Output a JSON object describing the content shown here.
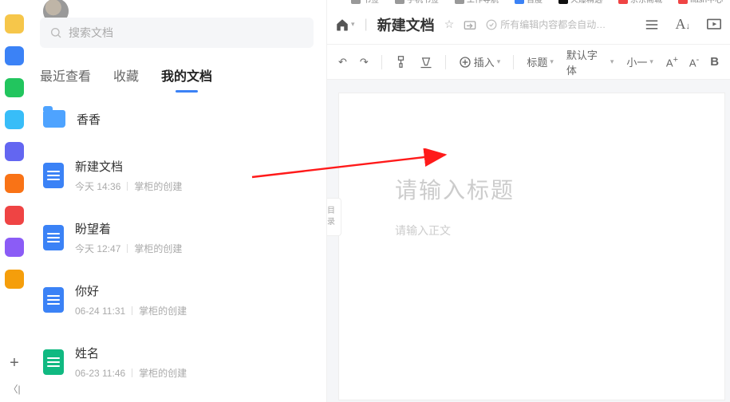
{
  "rail_colors": [
    "#f6c64a",
    "#3b82f6",
    "#22c55e",
    "#38bdf8",
    "#6366f1",
    "#f97316",
    "#ef4444",
    "#8b5cf6",
    "#f59e0b"
  ],
  "search": {
    "placeholder": "搜索文档"
  },
  "tabs": {
    "recent": "最近查看",
    "favorite": "收藏",
    "mydocs": "我的文档"
  },
  "folder": {
    "name": "香香"
  },
  "docs": [
    {
      "title": "新建文档",
      "time": "今天 14:36",
      "by": "掌柜的创建",
      "color": "blue"
    },
    {
      "title": "盼望着",
      "time": "今天 12:47",
      "by": "掌柜的创建",
      "color": "blue"
    },
    {
      "title": "你好",
      "time": "06-24 11:31",
      "by": "掌柜的创建",
      "color": "blue"
    },
    {
      "title": "姓名",
      "time": "06-23 11:46",
      "by": "掌柜的创建",
      "color": "green"
    }
  ],
  "bookmarks": [
    "书签",
    "手机书签",
    "工作导航",
    "百度",
    "火爆精选",
    "京东商城",
    "flash中心"
  ],
  "editor": {
    "doc_title": "新建文档",
    "autosave": "所有编辑内容都会自动…",
    "insert": "插入",
    "heading": "标题",
    "font": "默认字体",
    "size": "小一",
    "title_placeholder": "请输入标题",
    "body_placeholder": "请输入正文",
    "outline": "目\n录"
  }
}
